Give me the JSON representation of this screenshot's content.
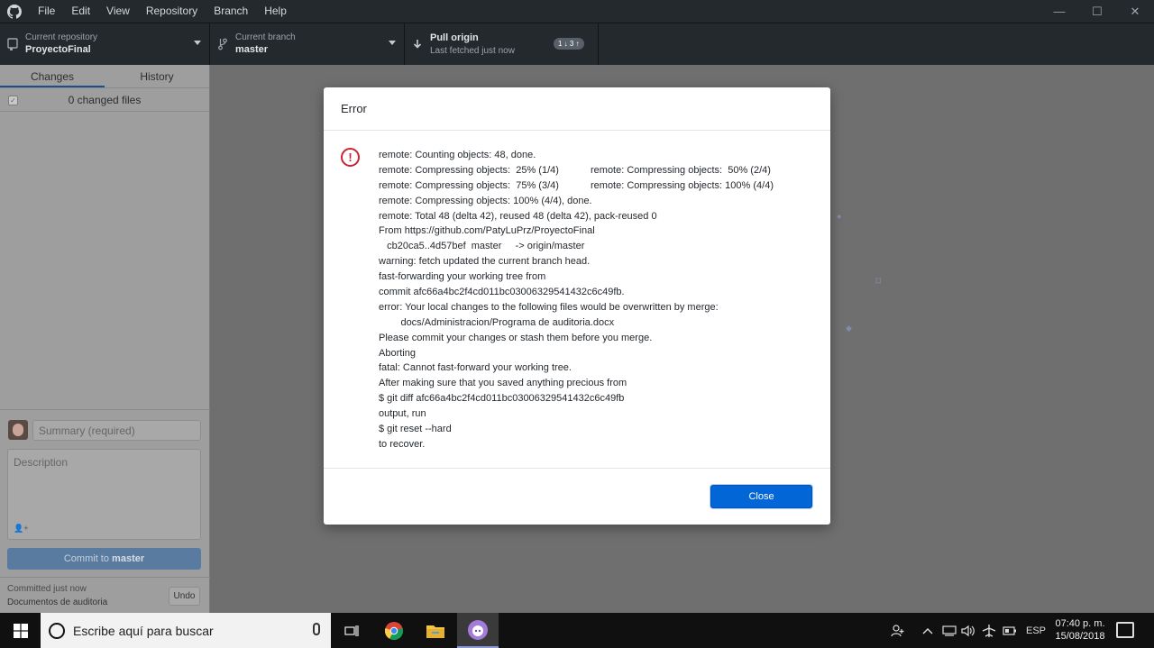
{
  "menu": {
    "items": [
      "File",
      "Edit",
      "View",
      "Repository",
      "Branch",
      "Help"
    ]
  },
  "window_controls": [
    "minimize-icon",
    "maximize-icon",
    "close-icon"
  ],
  "toolbar": {
    "repo_label": "Current repository",
    "repo_value": "ProyectoFinal",
    "branch_label": "Current branch",
    "branch_value": "master",
    "pull_label": "Pull origin",
    "pull_sub": "Last fetched just now",
    "pull_badge": "1 ↓ 3 ↑"
  },
  "sidebar": {
    "tabs": [
      "Changes",
      "History"
    ],
    "active_tab": "Changes",
    "changed_files": "0 changed files",
    "summary_placeholder": "Summary (required)",
    "description_placeholder": "Description",
    "commit_prefix": "Commit to ",
    "commit_branch": "master",
    "last_commit_status": "Committed just now",
    "last_commit_message": "Documentos de auditoria",
    "undo_label": "Undo"
  },
  "dialog": {
    "title": "Error",
    "close_label": "Close",
    "lines": [
      "remote: Counting objects: 48, done.",
      [
        "remote: Compressing objects:  25% (1/4)",
        "remote: Compressing objects:  50% (2/4)"
      ],
      [
        "remote: Compressing objects:  75% (3/4)",
        "remote: Compressing objects: 100% (4/4)"
      ],
      "remote: Compressing objects: 100% (4/4), done.",
      "remote: Total 48 (delta 42), reused 48 (delta 42), pack-reused 0",
      "From https://github.com/PatyLuPrz/ProyectoFinal",
      "   cb20ca5..4d57bef  master     -> origin/master",
      "warning: fetch updated the current branch head.",
      "fast-forwarding your working tree from",
      "commit afc66a4bc2f4cd011bc03006329541432c6c49fb.",
      "error: Your local changes to the following files would be overwritten by merge:",
      "        docs/Administracion/Programa de auditoria.docx",
      "Please commit your changes or stash them before you merge.",
      "Aborting",
      "fatal: Cannot fast-forward your working tree.",
      "After making sure that you saved anything precious from",
      "$ git diff afc66a4bc2f4cd011bc03006329541432c6c49fb",
      "output, run",
      "$ git reset --hard",
      "to recover."
    ]
  },
  "taskbar": {
    "search_placeholder": "Escribe aquí para buscar",
    "language": "ESP",
    "time": "07:40 p. m.",
    "date": "15/08/2018"
  }
}
